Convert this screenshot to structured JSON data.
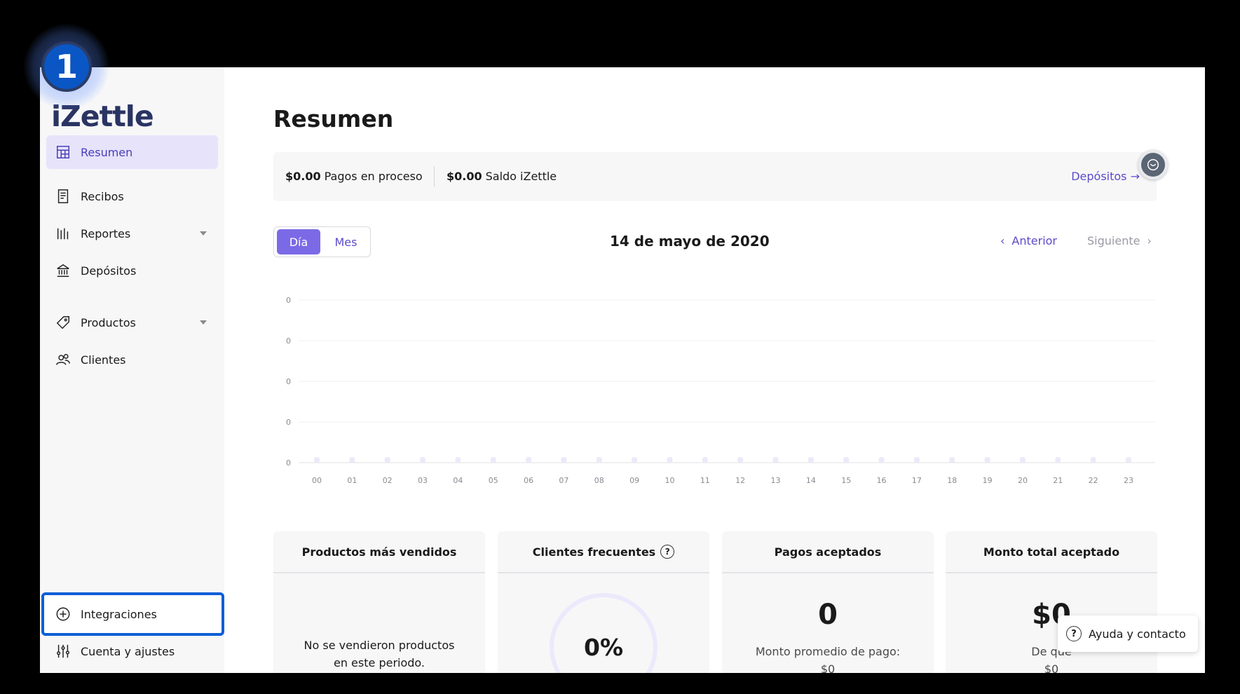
{
  "step_badge": "1",
  "logo": "iZettle",
  "sidebar": {
    "items": [
      {
        "label": "Resumen"
      },
      {
        "label": "Recibos"
      },
      {
        "label": "Reportes"
      },
      {
        "label": "Depósitos"
      },
      {
        "label": "Productos"
      },
      {
        "label": "Clientes"
      }
    ],
    "bottom": [
      {
        "label": "Integraciones"
      },
      {
        "label": "Cuenta y ajustes"
      }
    ]
  },
  "main": {
    "title": "Resumen",
    "summary": {
      "pending_amount": "$0.00",
      "pending_label": "Pagos en proceso",
      "balance_amount": "$0.00",
      "balance_label": "Saldo iZettle",
      "deposits_link": "Depósitos →"
    },
    "toggle": {
      "day": "Día",
      "month": "Mes"
    },
    "date": "14 de mayo de 2020",
    "prev": "Anterior",
    "next": "Siguiente"
  },
  "chart_data": {
    "type": "bar",
    "categories": [
      "00",
      "01",
      "02",
      "03",
      "04",
      "05",
      "06",
      "07",
      "08",
      "09",
      "10",
      "11",
      "12",
      "13",
      "14",
      "15",
      "16",
      "17",
      "18",
      "19",
      "20",
      "21",
      "22",
      "23"
    ],
    "values": [
      0,
      0,
      0,
      0,
      0,
      0,
      0,
      0,
      0,
      0,
      0,
      0,
      0,
      0,
      0,
      0,
      0,
      0,
      0,
      0,
      0,
      0,
      0,
      0
    ],
    "y_ticks": [
      "0",
      "0",
      "0",
      "0",
      "0"
    ],
    "grid": true
  },
  "cards": {
    "top_products": {
      "title": "Productos más vendidos",
      "empty": [
        "No se vendieron productos",
        "en este periodo."
      ]
    },
    "frequent_clients": {
      "title": "Clientes frecuentes",
      "help": "?",
      "value": "0%"
    },
    "accepted_payments": {
      "title": "Pagos aceptados",
      "value": "0",
      "sub": "Monto promedio de pago:",
      "sub_value": "$0"
    },
    "total_accepted": {
      "title": "Monto total aceptado",
      "value": "$0",
      "sub": "De qué",
      "sub_value": "$0"
    }
  },
  "help_button": {
    "label": "Ayuda y contacto",
    "icon": "?"
  },
  "colors": {
    "accent": "#7b6ae6",
    "link": "#5b4bc8",
    "highlight": "#0b5ed7"
  }
}
